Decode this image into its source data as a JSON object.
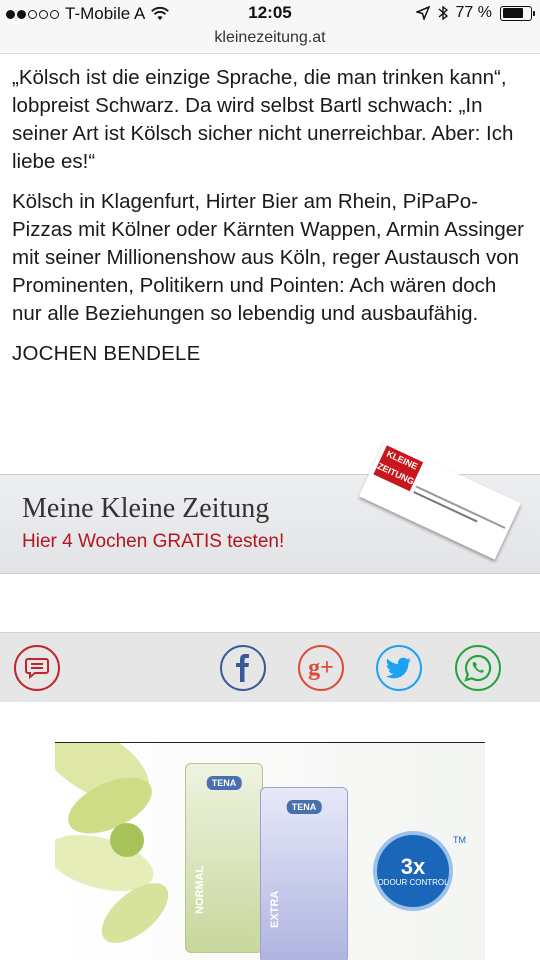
{
  "status_bar": {
    "carrier": "T-Mobile A",
    "time": "12:05",
    "battery": "77 %",
    "battery_level": 0.77
  },
  "browser": {
    "url": "kleinezeitung.at"
  },
  "article": {
    "paragraphs": [
      "„Kölsch ist die einzige Sprache, die man trinken kann“, lobpreist Schwarz. Da wird selbst Bartl schwach: „In seiner Art ist Kölsch sicher nicht unerreichbar. Aber: Ich liebe es!“",
      "Kölsch in Klagenfurt, Hirter Bier am Rhein, PiPaPo-Pizzas mit Kölner oder Kärnten Wappen, Armin Assinger mit seiner Millionenshow aus Köln, reger Austausch von Prominenten, Politikern und Pointen: Ach wären doch nur alle Beziehungen so lebendig und ausbaufähig."
    ],
    "author": "JOCHEN BENDELE"
  },
  "promo": {
    "title": "Meine Kleine Zeitung",
    "cta": "Hier 4 Wochen GRATIS testen!",
    "logo_text": "KLEINE ZEITUNG"
  },
  "share": {
    "icons": [
      "comments-icon",
      "facebook-icon",
      "google-plus-icon",
      "twitter-icon",
      "whatsapp-icon"
    ],
    "google_plus_glyph": "g+"
  },
  "ad": {
    "brand": "TENA",
    "product_1": "NORMAL",
    "product_2": "EXTRA",
    "badge_big": "3x",
    "badge_small": "ODOUR CONTROL",
    "trademark": "TM"
  },
  "colors": {
    "accent_red": "#b5161d",
    "facebook": "#3b5998",
    "google_plus": "#dd4b39",
    "twitter": "#1da1f2",
    "whatsapp": "#25a43b"
  }
}
